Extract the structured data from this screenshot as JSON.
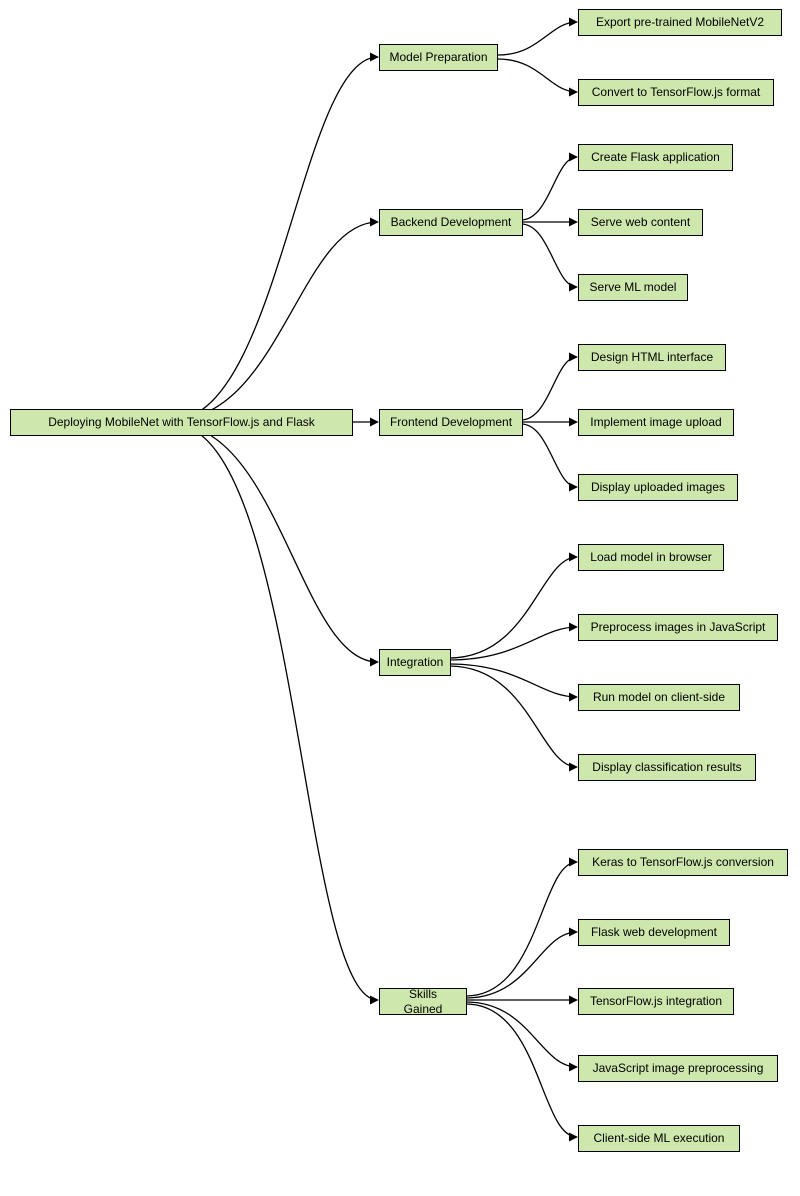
{
  "root": {
    "label": "Deploying MobileNet with TensorFlow.js and Flask"
  },
  "branches": [
    {
      "label": "Model Preparation",
      "children": [
        {
          "label": "Export pre-trained MobileNetV2"
        },
        {
          "label": "Convert to TensorFlow.js format"
        }
      ]
    },
    {
      "label": "Backend Development",
      "children": [
        {
          "label": "Create Flask application"
        },
        {
          "label": "Serve web content"
        },
        {
          "label": "Serve ML model"
        }
      ]
    },
    {
      "label": "Frontend Development",
      "children": [
        {
          "label": "Design HTML interface"
        },
        {
          "label": "Implement image upload"
        },
        {
          "label": "Display uploaded images"
        }
      ]
    },
    {
      "label": "Integration",
      "children": [
        {
          "label": "Load model in browser"
        },
        {
          "label": "Preprocess images in JavaScript"
        },
        {
          "label": "Run model on client-side"
        },
        {
          "label": "Display classification results"
        }
      ]
    },
    {
      "label": "Skills Gained",
      "children": [
        {
          "label": "Keras to TensorFlow.js conversion"
        },
        {
          "label": "Flask web development"
        },
        {
          "label": "TensorFlow.js integration"
        },
        {
          "label": "JavaScript image preprocessing"
        },
        {
          "label": "Client-side ML execution"
        }
      ]
    }
  ],
  "colors": {
    "node_fill": "#cde7ac",
    "node_stroke": "#000000",
    "edge_stroke": "#000000"
  }
}
